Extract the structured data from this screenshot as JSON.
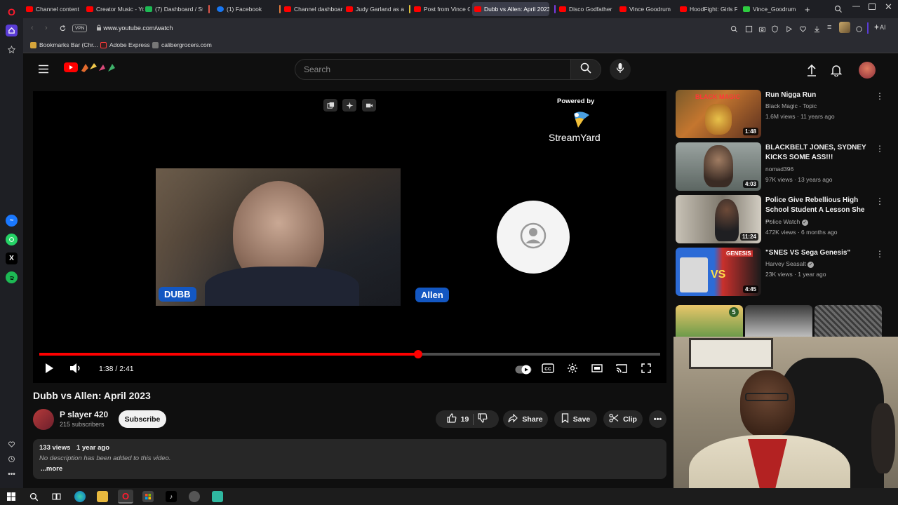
{
  "browser": {
    "tabs": [
      {
        "label": "Channel content",
        "color": "#ff0000",
        "active": false
      },
      {
        "label": "Creator Music - Yo",
        "color": "#ff0000",
        "active": false
      },
      {
        "label": "(7) Dashboard / St",
        "color": "#1db954",
        "active": false
      },
      {
        "label": "(1) Facebook",
        "color": "#1877f2",
        "active": false
      },
      {
        "label": "Channel dashboar",
        "color": "#ff0000",
        "active": false
      },
      {
        "label": "Judy Garland as a",
        "color": "#ff0000",
        "active": false
      },
      {
        "label": "Post from Vince G",
        "color": "#ff0000",
        "active": false
      },
      {
        "label": "Dubb vs Allen: April 2023",
        "color": "#ff0000",
        "active": true
      },
      {
        "label": "Disco Godfather",
        "color": "#ff0000",
        "active": false
      },
      {
        "label": "Vince Goodrum",
        "color": "#ff0000",
        "active": false
      },
      {
        "label": "HoodFight: Girls F",
        "color": "#ff0000",
        "active": false
      },
      {
        "label": "Vince_Goodrum",
        "color": "#2ecc40",
        "active": false
      }
    ],
    "new_tab_label": "+",
    "url": "www.youtube.com/watch",
    "vpn_label": "VPN",
    "ai_label": "AI",
    "bookmarks": [
      {
        "label": "Bookmarks Bar (Chr...",
        "icon": "folder-icon"
      },
      {
        "label": "Adobe Express",
        "icon": "adobe-icon"
      },
      {
        "label": "calibergrocers.com",
        "icon": "cart-icon"
      }
    ]
  },
  "youtube": {
    "search_placeholder": "Search",
    "player": {
      "powered_by": "Powered by",
      "brand": "StreamYard",
      "guest1_name": "DUBB",
      "guest2_name": "Allen",
      "time_current": "1:38",
      "time_total": "2:41",
      "time_display": "1:38 / 2:41",
      "progress_fraction": 0.61
    },
    "video": {
      "title": "Dubb vs Allen: April 2023",
      "channel": "P slayer 420",
      "subscribers": "215 subscribers",
      "subscribe_label": "Subscribe",
      "likes": "19",
      "share_label": "Share",
      "save_label": "Save",
      "clip_label": "Clip",
      "views": "133 views",
      "age": "1 year ago",
      "description": "No description has been added to this video.",
      "more_label": "...more"
    },
    "recommendations": [
      {
        "title": "Run Nigga Run",
        "channel": "Black Magic - Topic",
        "meta": "1.6M views · 11 years ago",
        "duration": "1:48",
        "thumb_text": "BLACK MAGIC",
        "verified": false
      },
      {
        "title": "BLACKBELT JONES, SYDNEY KICKS SOME ASS!!!",
        "channel": "nomad396",
        "meta": "97K views · 13 years ago",
        "duration": "4:03",
        "thumb_text": "",
        "verified": false
      },
      {
        "title": "Police Give Rebellious High School Student A Lesson She ...",
        "channel": "Police Watch",
        "meta": "472K views · 6 months ago",
        "duration": "11:24",
        "thumb_text": "",
        "verified": true
      },
      {
        "title": "\"SNES VS Sega Genesis\"",
        "channel": "Harvey Seasalt",
        "meta": "23K views · 1 year ago",
        "duration": "4:45",
        "thumb_text": "GENESIS",
        "verified": true
      }
    ],
    "shorts_badge": "5"
  },
  "colors": {
    "youtube_red": "#ff0000",
    "streamyard_blue": "#1357c2",
    "bg": "#0f0f0f"
  }
}
